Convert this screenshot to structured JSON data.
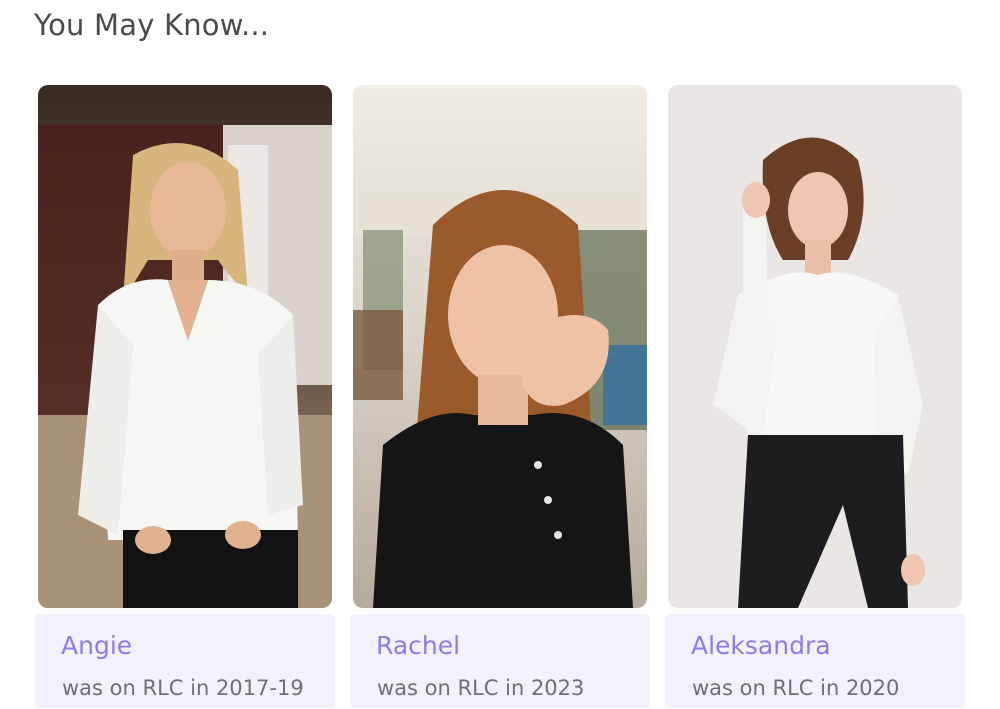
{
  "section": {
    "title": "You May Know..."
  },
  "people": [
    {
      "name": "Angie",
      "status": "was on RLC in 2017-19"
    },
    {
      "name": "Rachel",
      "status": "was on RLC in 2023"
    },
    {
      "name": "Aleksandra",
      "status": "was on RLC in 2020"
    }
  ],
  "colors": {
    "name_link": "#8e7bea",
    "card_footer_bg": "#f4f1fd",
    "title_text": "#4a4a4f",
    "meta_text": "#6f6f74"
  }
}
